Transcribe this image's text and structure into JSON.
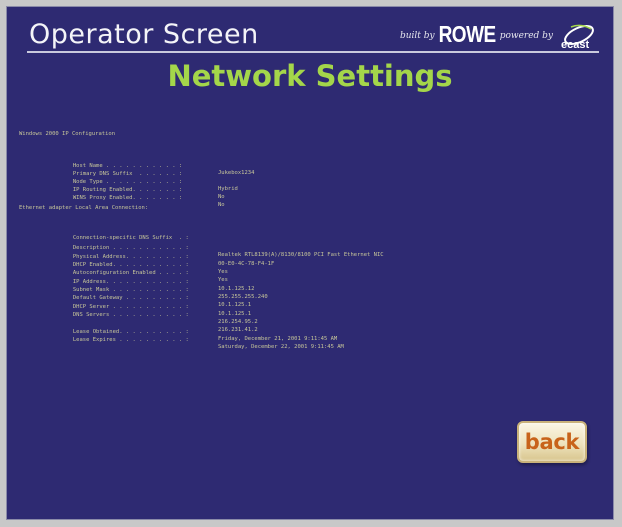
{
  "header": {
    "title": "Operator Screen",
    "brand_built_by": "built by",
    "brand_rowe": "ROWE",
    "brand_powered_by": "powered by",
    "brand_ecast": "ecast"
  },
  "page": {
    "title": "Network Settings"
  },
  "settings": {
    "sections": [
      {
        "title": "Windows 2000 IP Configuration",
        "rows": [
          {
            "label": "Host Name . . . . . . . . . . . :",
            "value": "Jukebox1234"
          },
          {
            "label": "Primary DNS Suffix  . . . . . . :",
            "value": ""
          },
          {
            "label": "Node Type . . . . . . . . . . . :",
            "value": "Hybrid"
          },
          {
            "label": "IP Routing Enabled. . . . . . . :",
            "value": "No"
          },
          {
            "label": "WINS Proxy Enabled. . . . . . . :",
            "value": "No"
          }
        ]
      },
      {
        "title": "Ethernet adapter Local Area Connection:",
        "rows": [
          {
            "label": "Connection-specific DNS Suffix  . :",
            "value": ""
          },
          {
            "label": "Description . . . . . . . . . . . :",
            "value": "Realtek RTL8139(A)/8130/8100 PCI Fast Ethernet NIC"
          },
          {
            "label": "Physical Address. . . . . . . . . :",
            "value": "00-E0-4C-78-F4-1F"
          },
          {
            "label": "DHCP Enabled. . . . . . . . . . . :",
            "value": "Yes"
          },
          {
            "label": "Autoconfiguration Enabled . . . . :",
            "value": "Yes"
          },
          {
            "label": "IP Address. . . . . . . . . . . . :",
            "value": "10.1.125.12"
          },
          {
            "label": "Subnet Mask . . . . . . . . . . . :",
            "value": "255.255.255.240"
          },
          {
            "label": "Default Gateway . . . . . . . . . :",
            "value": "10.1.125.1"
          },
          {
            "label": "DHCP Server . . . . . . . . . . . :",
            "value": "10.1.125.1"
          },
          {
            "label": "DNS Servers . . . . . . . . . . . :",
            "value": "216.254.95.2"
          },
          {
            "label": "",
            "value": "216.231.41.2"
          },
          {
            "label": "Lease Obtained. . . . . . . . . . :",
            "value": "Friday, December 21, 2001 9:11:45 AM"
          },
          {
            "label": "Lease Expires . . . . . . . . . . :",
            "value": "Saturday, December 22, 2001 9:11:45 AM"
          }
        ]
      }
    ]
  },
  "buttons": {
    "back_label": "back"
  },
  "colors": {
    "background": "#2e2a72",
    "title_green": "#a4d64a",
    "text_tan": "#c8c79a",
    "back_orange": "#c8631a"
  }
}
